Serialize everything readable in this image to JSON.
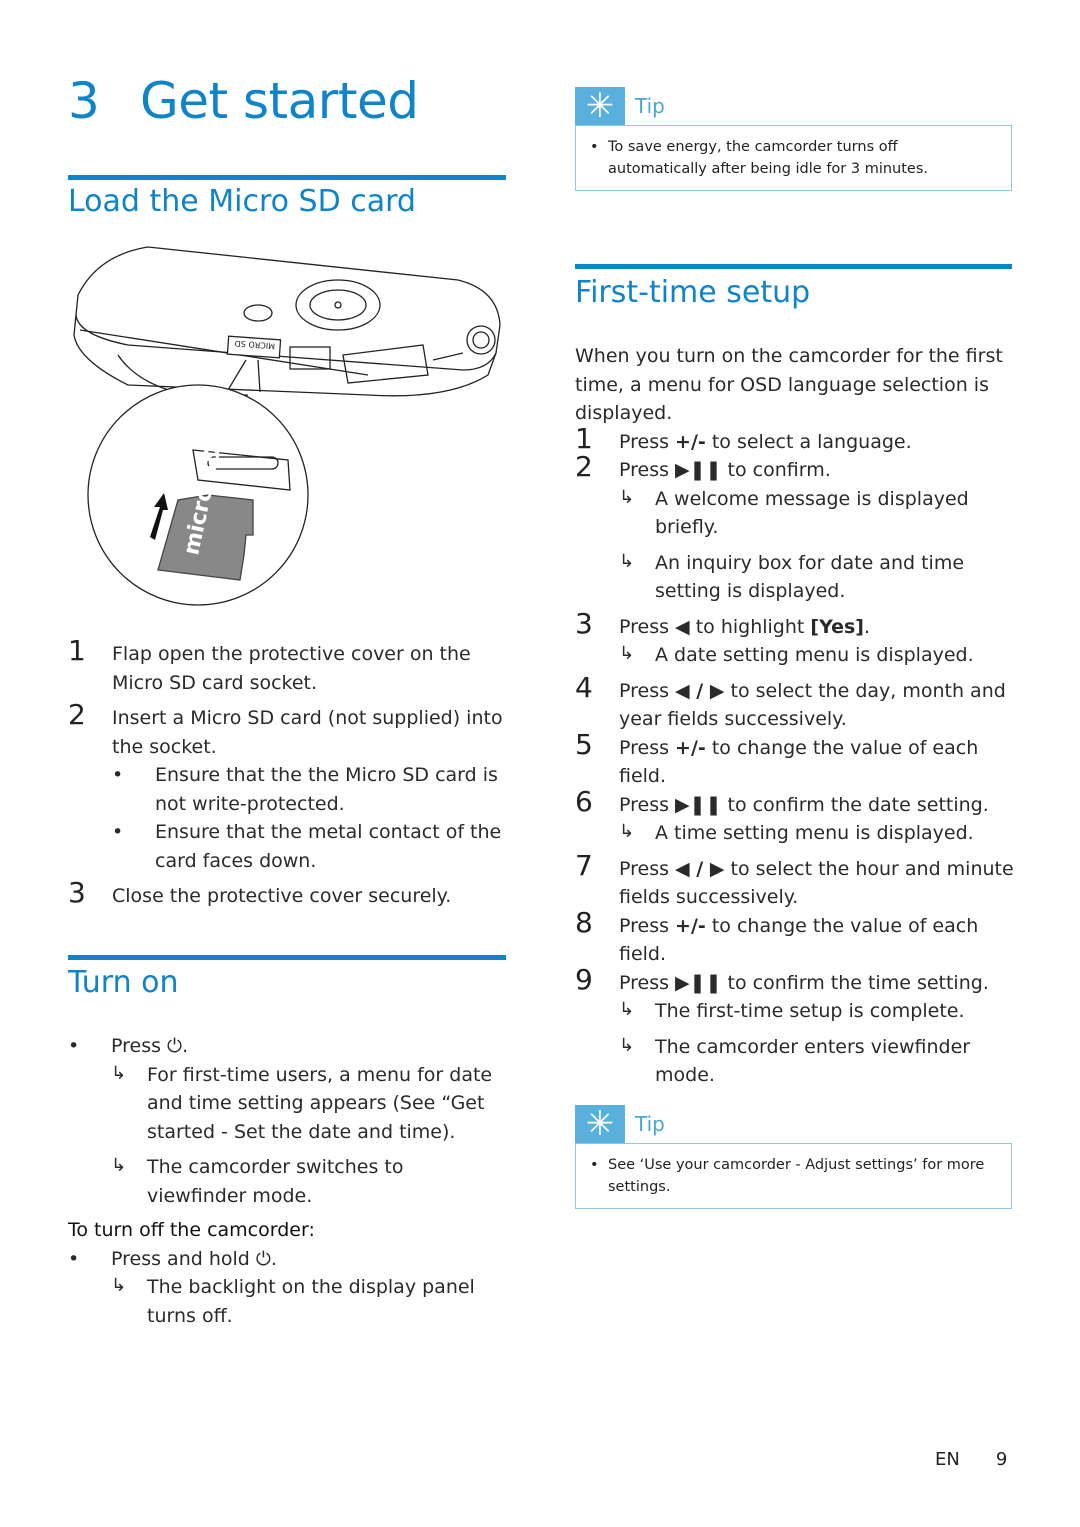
{
  "chapter": {
    "number": "3",
    "title": "Get started"
  },
  "sections": {
    "load_card": {
      "title": "Load the Micro SD card",
      "illustration": {
        "label": "MICRO SD",
        "card_text": "micro SD"
      },
      "steps": [
        {
          "num": "1",
          "text": "Flap open the protective cover on the Micro SD card socket."
        },
        {
          "num": "2",
          "text": "Insert a Micro SD card (not supplied) into the socket.",
          "bullets": [
            "Ensure that the the Micro SD card is not write-protected.",
            "Ensure that the metal contact of the card faces down."
          ]
        },
        {
          "num": "3",
          "text": "Close the protective cover securely."
        }
      ]
    },
    "turn_on": {
      "title": "Turn on",
      "bullet": "Press ⏻.",
      "results": [
        "For first-time users, a menu for date and time setting appears (See “Get started - Set the date and time).",
        "The camcorder switches to viewfinder mode."
      ],
      "off_heading": "To turn off the camcorder:",
      "off_bullet": "Press and hold ⏻.",
      "off_result": "The backlight on the display panel turns off."
    },
    "first_time_setup": {
      "title": "First-time setup",
      "intro": "When you turn on the camcorder for the first time, a menu for OSD language selection is displayed.",
      "steps": [
        {
          "num": "1",
          "pre": "Press ",
          "key": "+/-",
          "post": " to select a language.",
          "results": []
        },
        {
          "num": "2",
          "pre": "Press ",
          "key": "▶❚❚",
          "post": " to confirm.",
          "results": [
            "A welcome message is displayed briefly.",
            "An inquiry box for date and time setting is displayed."
          ]
        },
        {
          "num": "3",
          "pre": "Press ",
          "key": "◀",
          "post": " to highlight ",
          "key2": "[Yes]",
          "post2": ".",
          "results": [
            "A date setting menu is displayed."
          ]
        },
        {
          "num": "4",
          "pre": "Press ",
          "key": "◀ / ▶",
          "post": " to select the day, month and year fields successively.",
          "results": []
        },
        {
          "num": "5",
          "pre": "Press ",
          "key": "+/-",
          "post": " to change the value of each field.",
          "results": []
        },
        {
          "num": "6",
          "pre": "Press ",
          "key": "▶❚❚",
          "post": " to confirm the date setting.",
          "results": [
            "A time setting menu is displayed."
          ]
        },
        {
          "num": "7",
          "pre": "Press ",
          "key": "◀ / ▶",
          "post": " to select the hour and minute fields successively.",
          "results": []
        },
        {
          "num": "8",
          "pre": "Press ",
          "key": "+/-",
          "post": " to change the value of each field.",
          "results": []
        },
        {
          "num": "9",
          "pre": "Press ",
          "key": "▶❚❚",
          "post": " to confirm the time setting.",
          "results": [
            "The first-time setup is complete.",
            "The camcorder enters viewfinder mode."
          ]
        }
      ]
    }
  },
  "tips": [
    {
      "label": "Tip",
      "text": "To save energy, the camcorder turns off automatically after being idle for 3 minutes."
    },
    {
      "label": "Tip",
      "text": "See ‘Use your camcorder - Adjust settings’ for more settings."
    }
  ],
  "symbols": {
    "bullet": "•",
    "result_arrow": "↳",
    "tip_icon": "✳"
  },
  "footer": {
    "lang": "EN",
    "page": "9"
  },
  "colors": {
    "accent": "#0f84c8",
    "tip": "#5ab0dc"
  }
}
